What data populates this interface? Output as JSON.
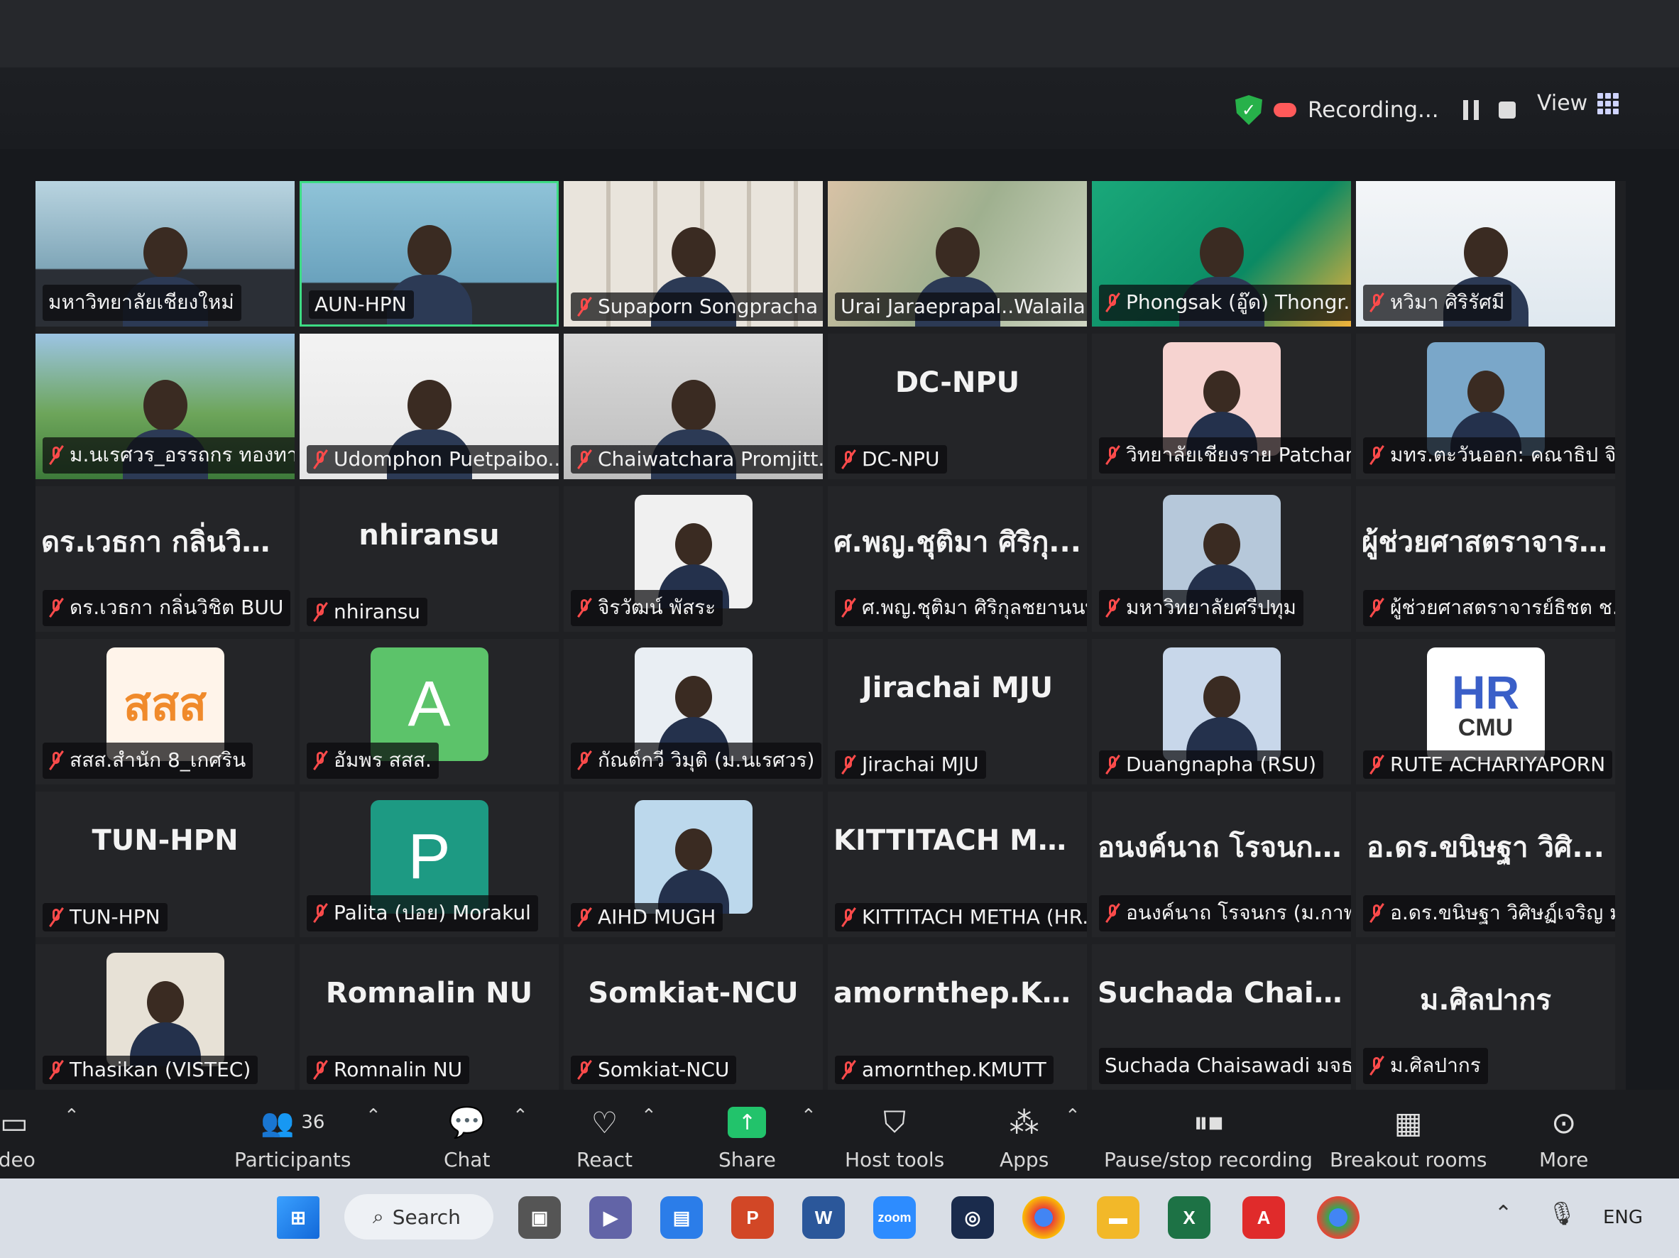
{
  "header": {
    "recording_label": "Recording...",
    "view_label": "View"
  },
  "tiles": [
    {
      "name": "มหาวิทยาลัยเชียงใหม่",
      "big": "",
      "muted": false,
      "video": "room",
      "highlight": false
    },
    {
      "name": "AUN-HPN",
      "big": "",
      "muted": false,
      "video": "office",
      "highlight": true
    },
    {
      "name": "Supaporn Songpracha",
      "big": "",
      "muted": true,
      "video": "shelf",
      "highlight": false
    },
    {
      "name": "Urai Jaraeprapal..Walailak...",
      "big": "",
      "muted": false,
      "video": "blur",
      "highlight": false
    },
    {
      "name": "Phongsak (อู๊ด) Thongr...",
      "big": "",
      "muted": true,
      "video": "green",
      "highlight": false
    },
    {
      "name": "หวิมา ศิริรัศมี",
      "big": "",
      "muted": true,
      "video": "slide",
      "highlight": false
    },
    {
      "name": "ม.นเรศวร_อรรถกร ทองทา",
      "big": "",
      "muted": true,
      "video": "campus",
      "highlight": false
    },
    {
      "name": "Udomphon Puetpaibo...",
      "big": "",
      "muted": true,
      "video": "map",
      "highlight": false
    },
    {
      "name": "Chaiwatchara Promjitt...",
      "big": "",
      "muted": true,
      "video": "suit",
      "highlight": false
    },
    {
      "name": "DC-NPU",
      "big": "DC-NPU",
      "muted": true,
      "video": "",
      "highlight": false
    },
    {
      "name": "วิทยาลัยเชียงราย Patchar...",
      "big": "",
      "muted": true,
      "video": "avatar-pink",
      "highlight": false
    },
    {
      "name": "มทร.ตะวันออก: คณาธิป จิ...",
      "big": "",
      "muted": true,
      "video": "avatar-blue",
      "highlight": false
    },
    {
      "name": "ดร.เวธกา กลิ่นวิชิต BUU",
      "big": "ดร.เวธกา กลิ่นวิชิ...",
      "muted": true,
      "video": "",
      "highlight": false
    },
    {
      "name": "nhiransu",
      "big": "nhiransu",
      "muted": true,
      "video": "",
      "highlight": false
    },
    {
      "name": "จิรวัฒน์ พัสระ",
      "big": "",
      "muted": true,
      "video": "avatar-white",
      "highlight": false
    },
    {
      "name": "ศ.พญ.ชุติมา ศิริกุลชยานนท์",
      "big": "ศ.พญ.ชุติมา ศิริกุ...",
      "muted": true,
      "video": "",
      "highlight": false
    },
    {
      "name": "มหาวิทยาลัยศรีปทุม",
      "big": "",
      "muted": true,
      "video": "avatar-room",
      "highlight": false
    },
    {
      "name": "ผู้ช่วยศาสตราจารย์ธิชต ช...",
      "big": "ผู้ช่วยศาสตราจาร...",
      "muted": true,
      "video": "",
      "highlight": false
    },
    {
      "name": "สสส.สำนัก 8_เกศริน",
      "big": "",
      "muted": true,
      "video": "logo-sss",
      "logo_text": "สสส",
      "highlight": false
    },
    {
      "name": "อัมพร สสส.",
      "big": "",
      "muted": true,
      "video": "letter-green",
      "letter": "A",
      "highlight": false
    },
    {
      "name": "กัณต์กวี วิมุติ (ม.นเรศวร)",
      "big": "",
      "muted": true,
      "video": "avatar-white2",
      "highlight": false
    },
    {
      "name": "Jirachai MJU",
      "big": "Jirachai MJU",
      "muted": true,
      "video": "",
      "highlight": false
    },
    {
      "name": "Duangnapha (RSU)",
      "big": "",
      "muted": true,
      "video": "avatar-navy",
      "highlight": false
    },
    {
      "name": "RUTE ACHARIYAPORN",
      "big": "",
      "muted": true,
      "video": "logo-hr",
      "logo_text": "HR",
      "logo_sub": "CMU",
      "highlight": false
    },
    {
      "name": "TUN-HPN",
      "big": "TUN-HPN",
      "muted": true,
      "video": "",
      "highlight": false
    },
    {
      "name": "Palita (ปอย) Morakul",
      "big": "",
      "muted": true,
      "video": "letter-teal",
      "letter": "P",
      "highlight": false
    },
    {
      "name": "AIHD MUGH",
      "big": "",
      "muted": true,
      "video": "avatar-poster",
      "highlight": false
    },
    {
      "name": "KITTITACH METHA (HR...",
      "big": "KITTITACH MET...",
      "muted": true,
      "video": "",
      "highlight": false
    },
    {
      "name": "อนงค์นาถ โรจนกร (ม.กาฬ...",
      "big": "อนงค์นาถ โรจนก...",
      "muted": true,
      "video": "",
      "highlight": false
    },
    {
      "name": "อ.ดร.ขนิษฐา วิศิษฏ์เจริญ ม...",
      "big": "อ.ดร.ขนิษฐา วิศิ...",
      "muted": true,
      "video": "",
      "highlight": false
    },
    {
      "name": "Thasikan (VISTEC)",
      "big": "",
      "muted": true,
      "video": "avatar-lab",
      "highlight": false
    },
    {
      "name": "Romnalin NU",
      "big": "Romnalin NU",
      "muted": true,
      "video": "",
      "highlight": false
    },
    {
      "name": "Somkiat-NCU",
      "big": "Somkiat-NCU",
      "muted": true,
      "video": "",
      "highlight": false
    },
    {
      "name": "amornthep.KMUTT",
      "big": "amornthep.KM...",
      "muted": true,
      "video": "",
      "highlight": false
    },
    {
      "name": "Suchada Chaisawadi มจธ",
      "big": "Suchada Chaisa...",
      "muted": false,
      "video": "",
      "highlight": false
    },
    {
      "name": "ม.ศิลปากร",
      "big": "ม.ศิลปากร",
      "muted": true,
      "video": "",
      "highlight": false
    }
  ],
  "toolbar": {
    "video_label": "ideo",
    "participants_label": "Participants",
    "participants_count": "36",
    "chat_label": "Chat",
    "react_label": "React",
    "share_label": "Share",
    "host_tools_label": "Host tools",
    "apps_label": "Apps",
    "pause_stop_label": "Pause/stop recording",
    "breakout_label": "Breakout rooms",
    "more_label": "More"
  },
  "taskbar": {
    "search_label": "Search",
    "zoom_label": "zoom",
    "lang": "ENG"
  }
}
